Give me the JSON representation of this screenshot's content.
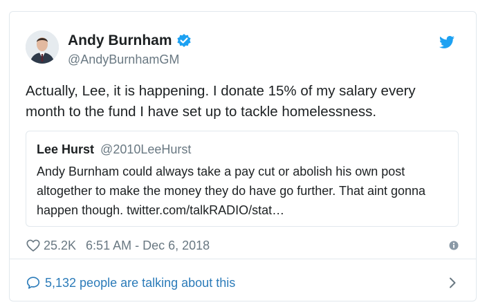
{
  "author": {
    "display_name": "Andy Burnham",
    "handle": "@AndyBurnhamGM",
    "verified_icon": "verified-badge-icon"
  },
  "tweet": {
    "text": "Actually, Lee, it is happening. I donate 15% of my salary every month to the fund I have set up to tackle homelessness."
  },
  "quote": {
    "name": "Lee Hurst",
    "handle": "@2010LeeHurst",
    "text": "Andy Burnham could always take a pay cut or abolish his own post altogether to make the money they do have go further. That aint gonna happen though. twitter.com/talkRADIO/stat…"
  },
  "meta": {
    "likes": "25.2K",
    "timestamp": "6:51 AM - Dec 6, 2018"
  },
  "footer": {
    "talking": "5,132 people are talking about this"
  },
  "colors": {
    "brand_blue": "#1da1f2",
    "link_blue": "#2b7bb9",
    "muted": "#697882",
    "border": "#e1e8ed"
  },
  "icons": [
    "twitter-bird-icon",
    "heart-icon",
    "info-icon",
    "speech-bubble-icon",
    "chevron-right-icon"
  ]
}
